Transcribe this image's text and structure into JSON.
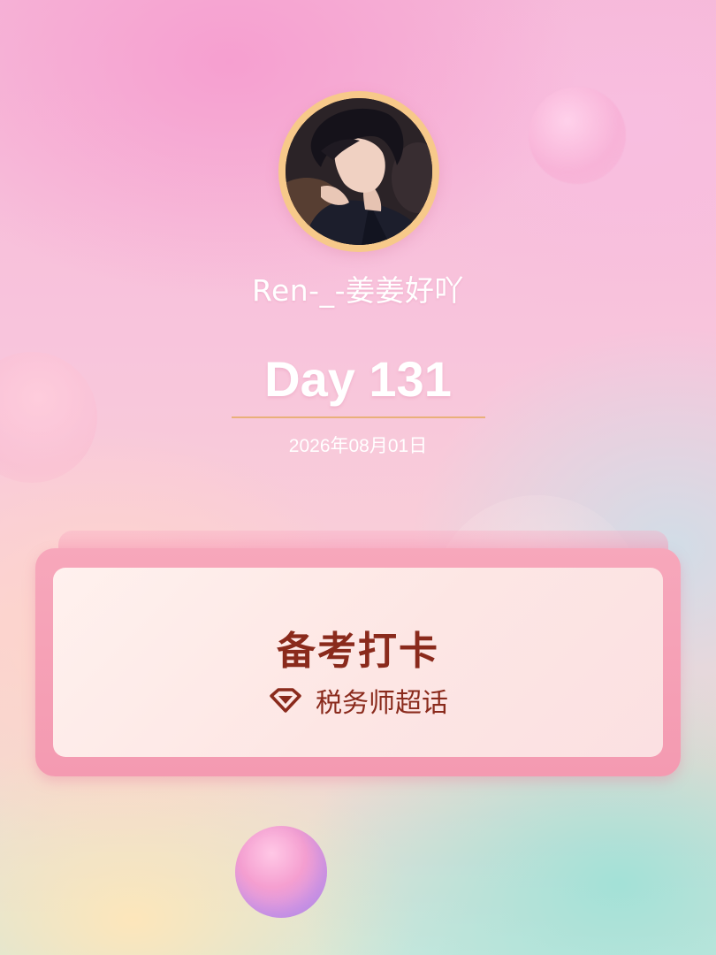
{
  "profile": {
    "username": "Ren-_-姜姜好吖"
  },
  "checkin": {
    "day_label": "Day 131",
    "date": "2026年08月01日"
  },
  "card": {
    "title": "备考打卡",
    "topic": "税务师超话",
    "topic_icon": "diamond-icon"
  },
  "colors": {
    "accent_text": "#8a2a1c",
    "card_frame": "#f4a2b7",
    "divider": "#e9b07a",
    "avatar_ring": "#f7c98a"
  }
}
